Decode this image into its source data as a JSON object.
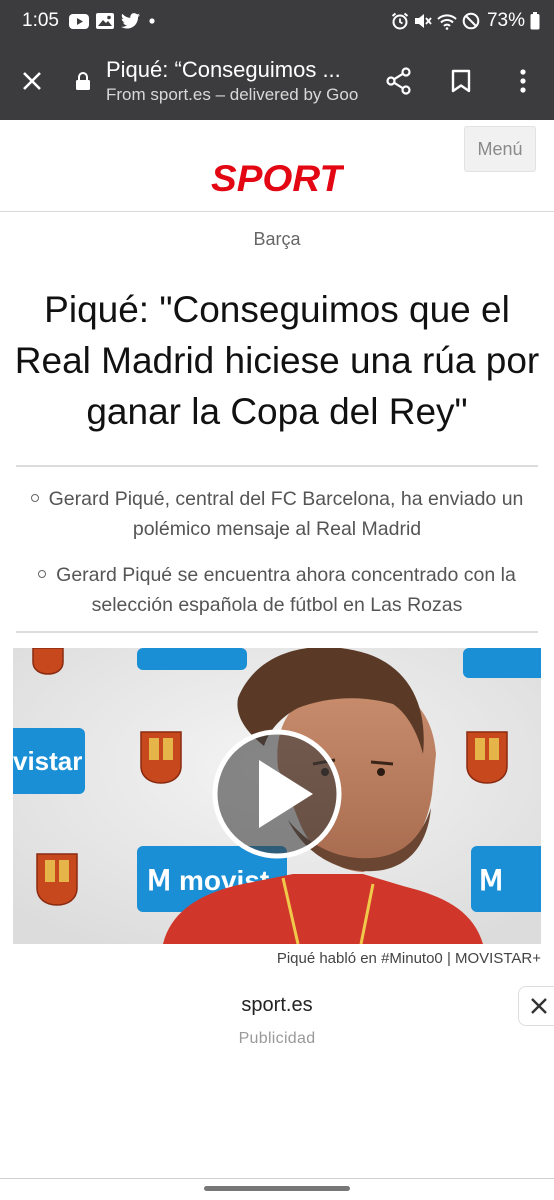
{
  "status_bar": {
    "time": "1:05",
    "battery": "73%",
    "left_icons": [
      "youtube-icon",
      "gallery-icon",
      "twitter-icon",
      "dot-icon"
    ],
    "right_icons": [
      "alarm-icon",
      "mute-icon",
      "wifi-icon",
      "dnd-icon",
      "battery-icon"
    ]
  },
  "browser": {
    "title": "Piqué: “Conseguimos ...",
    "origin": "From sport.es – delivered by Goo"
  },
  "site": {
    "logo_text": "SPORT",
    "logo_color": "#e30613",
    "menu_label": "Menú"
  },
  "article": {
    "section": "Barça",
    "headline": "Piqué: \"Conseguimos que el Real Madrid hiciese una rúa por ganar la Copa del Rey\"",
    "bullets": [
      "Gerard Piqué, central del FC Barcelona, ha enviado un polémico mensaje al Real Madrid",
      "Gerard Piqué se encuentra ahora concentrado con la selección española de fútbol en Las Rozas"
    ],
    "video_caption": "Piqué habló en #Minuto0 | MOVISTAR+"
  },
  "ad": {
    "site": "sport.es",
    "label": "Publicidad"
  }
}
